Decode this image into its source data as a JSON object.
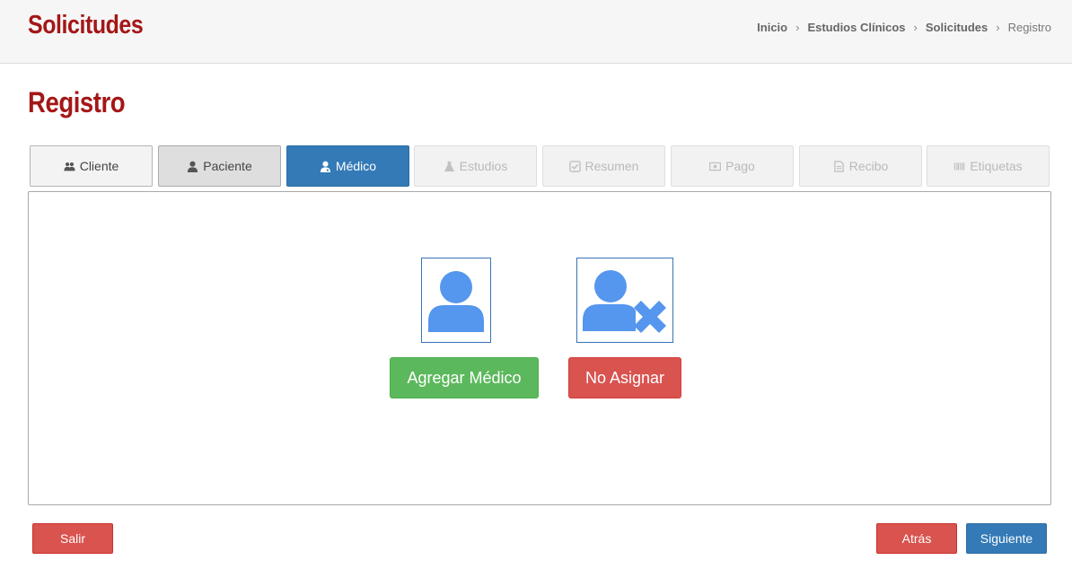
{
  "header": {
    "app_title": "Solicitudes",
    "breadcrumb": [
      {
        "label": "Inicio"
      },
      {
        "label": "Estudios Clínicos"
      },
      {
        "label": "Solicitudes"
      },
      {
        "label": "Registro"
      }
    ],
    "separator": "›"
  },
  "page": {
    "title": "Registro"
  },
  "tabs": [
    {
      "label": "Cliente",
      "icon": "users-icon",
      "state": "enabled"
    },
    {
      "label": "Paciente",
      "icon": "user-icon",
      "state": "completed"
    },
    {
      "label": "Médico",
      "icon": "user-md-icon",
      "state": "active"
    },
    {
      "label": "Estudios",
      "icon": "flask-icon",
      "state": "disabled"
    },
    {
      "label": "Resumen",
      "icon": "check-square-icon",
      "state": "disabled"
    },
    {
      "label": "Pago",
      "icon": "money-icon",
      "state": "disabled"
    },
    {
      "label": "Recibo",
      "icon": "file-text-icon",
      "state": "disabled"
    },
    {
      "label": "Etiquetas",
      "icon": "barcode-icon",
      "state": "disabled"
    }
  ],
  "panel": {
    "add_doctor_icon": "user-icon",
    "no_assign_icon": "user-times-icon",
    "add_doctor_label": "Agregar Médico",
    "no_assign_label": "No Asignar"
  },
  "footer": {
    "exit_label": "Salir",
    "back_label": "Atrás",
    "next_label": "Siguiente"
  },
  "colors": {
    "brand_red": "#a41717",
    "primary_blue": "#337ab7",
    "success_green": "#5cb85c",
    "danger_red": "#d9534f",
    "icon_blue": "#5596ee"
  }
}
